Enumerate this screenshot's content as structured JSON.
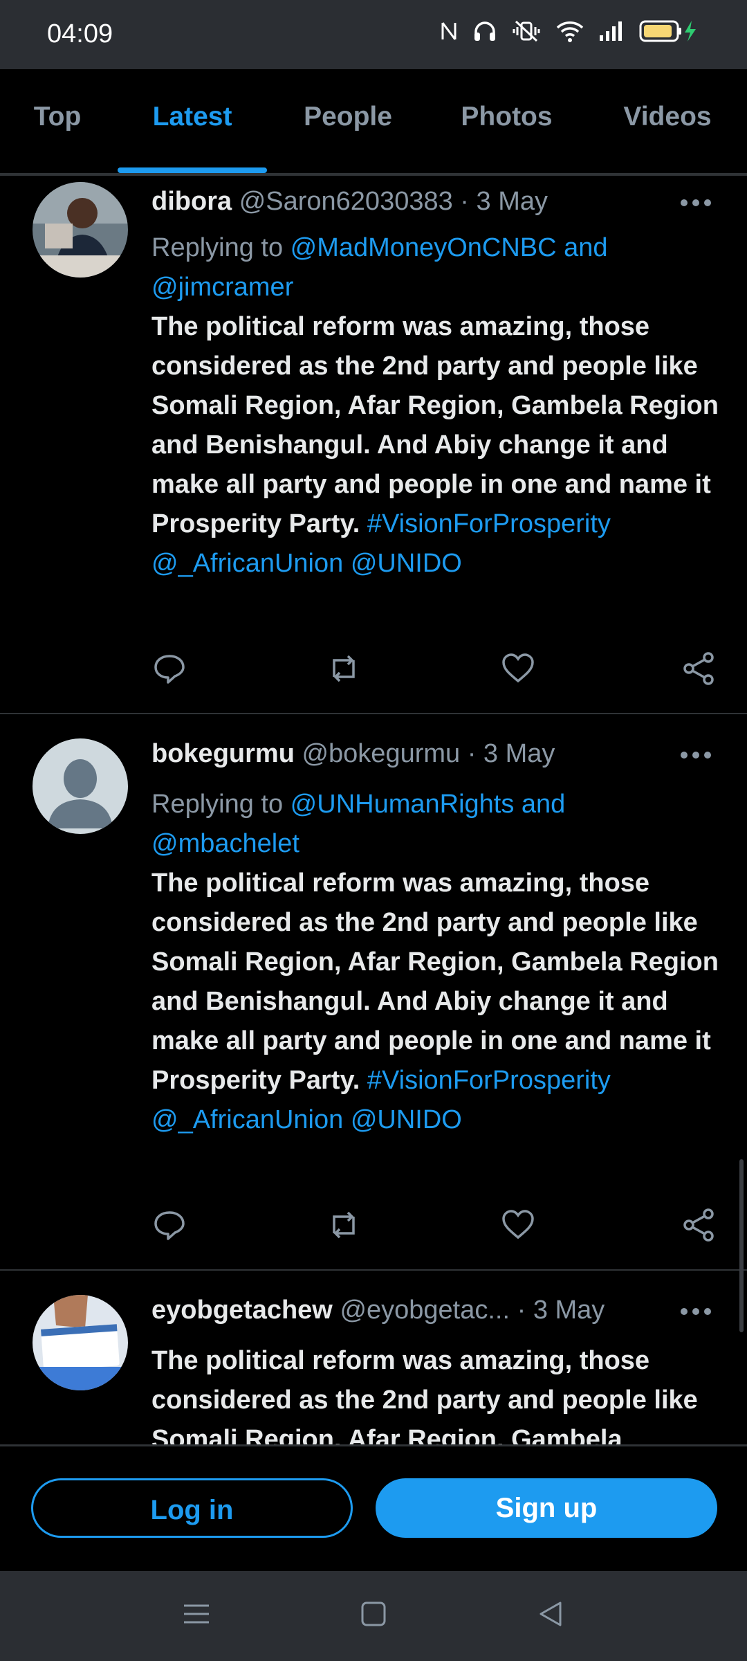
{
  "status_bar": {
    "time": "04:09",
    "icons": [
      "nfc-icon",
      "headphones-icon",
      "vibrate-off-icon",
      "wifi-icon",
      "signal-icon",
      "battery-charging-icon"
    ]
  },
  "tabs": [
    {
      "label": "Top",
      "active": false
    },
    {
      "label": "Latest",
      "active": true
    },
    {
      "label": "People",
      "active": false
    },
    {
      "label": "Photos",
      "active": false
    },
    {
      "label": "Videos",
      "active": false
    }
  ],
  "tweets": [
    {
      "name": "dibora",
      "meta": "@Saron62030383 · 3 May",
      "reply_prefix": "Replying to ",
      "reply_mentions": "@MadMoneyOnCNBC and @jimcramer",
      "text": "The political reform was amazing, those considered as the 2nd party and people like Somali Region, Afar Region, Gambela Region and Benishangul. And Abiy change it and make all party and people in one and name it Prosperity Party.",
      "tags": "#VisionForProsperity @_AfricanUnion @UNIDO"
    },
    {
      "name": "bokegurmu",
      "meta": "@bokegurmu · 3 May",
      "reply_prefix": "Replying to ",
      "reply_mentions": "@UNHumanRights and @mbachelet",
      "text": "The political reform was amazing, those considered as the 2nd party and people like Somali Region, Afar Region, Gambela Region and Benishangul. And Abiy change it and make all party and people in one and name it Prosperity Party.",
      "tags": "#VisionForProsperity @_AfricanUnion @UNIDO"
    },
    {
      "name": "eyobgetachew",
      "meta": "@eyobgetac... · 3 May",
      "text": "The political reform was amazing, those considered as the 2nd party and people like Somali Region, Afar Region, Gambela"
    }
  ],
  "bottom": {
    "login_label": "Log in",
    "signup_label": "Sign up"
  },
  "colors": {
    "accent": "#1d9bf0",
    "muted": "#8b98a5",
    "divider": "#2f3336"
  }
}
